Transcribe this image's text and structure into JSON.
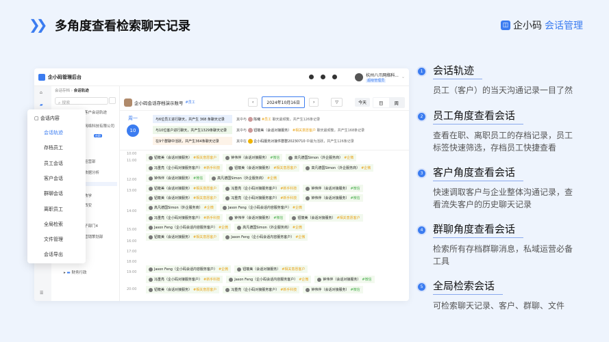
{
  "header": {
    "title": "多角度查看检索聊天记录",
    "brand_a": "企小码",
    "brand_b": "会话管理"
  },
  "app": {
    "name": "企小码管理后台",
    "user": "杭州八爪网络科...",
    "role": "超级管理员",
    "breadcrumb": [
      "会话存档",
      "会话轨迹"
    ],
    "search_placeholder": "搜索",
    "tree_header": "客户会话轨迹",
    "tree_items": [
      "网络科技有限公司",
      "",
      "",
      "运营部",
      "数据分析",
      "",
      "教学",
      "西安",
      "",
      "子部门4",
      "营销策划部",
      "",
      "",
      "财务行政"
    ],
    "tree_tag": "在职",
    "account": "企小码会话存档演示账号",
    "account_tag": "#员工",
    "date": "2024年10月16日",
    "today": "今天",
    "day": "日",
    "week": "周",
    "weekday": "周一",
    "daynum": "10",
    "summary": [
      {
        "text": "与6位员工进行聊天，共产生 368 条聊天记录",
        "detail_pre": "其中与",
        "name": "陈曦",
        "tag": "#员工",
        "detail": "聊天最频繁，共产生126条记录",
        "bg": "#e8f0fd"
      },
      {
        "text": "与10位客户进行聊天，共产生1329条聊天记录",
        "detail_pre": "其中与",
        "name": "钮筱美（会话对接服务）",
        "tag": "#相关意愿客户",
        "detail": "聊天最频繁，共产生168条记录",
        "bg": "#edf7e9"
      },
      {
        "text": "在9个群聊中活跃，共产生364条聊天记录",
        "detail_pre": "其中在",
        "name": "企小码服务对接件群群20230710",
        "tag": "",
        "detail": "中最为活跃，共产生126条记录",
        "bg": "#fdf3e8"
      }
    ],
    "times": [
      "10:00",
      "11:00",
      "12:00",
      "13:00",
      "14:00",
      "15:00",
      "16:00",
      "17:00",
      "18:00",
      "19:00",
      "20:00"
    ],
    "rows": [
      [
        [
          "钮筱美（会话对接服务）",
          "#相关意愿客户",
          1
        ],
        [
          "钟伟伴（会话对接服务）",
          "#微信",
          2
        ],
        [
          "高凡德国Simon（外企服务商）",
          "#企微",
          1
        ]
      ],
      [
        [
          "冯重亮（企小码对接服务客户）",
          "#新手科技",
          1
        ],
        [
          "钮筱美（会话对接服务）",
          "#相关意愿客户",
          1
        ],
        [
          "高凡德国Simon（外企服务商）",
          "#企微",
          1
        ]
      ],
      [
        [
          "钟伟伴（会话对接服务）",
          "#微信",
          2
        ],
        [
          "高凡德国Simon（外企服务商）",
          "#企微",
          1
        ]
      ],
      [
        [
          "钮筱美（会话对接服务）",
          "#相关意愿客户",
          1
        ],
        [
          "冯重亮（企小码对接服务客户）",
          "#新手科技",
          1
        ],
        [
          "钟伟伴（会话对接服务）",
          "#微信",
          2
        ]
      ],
      [
        [
          "钮筱美（会话对接服务）",
          "#相关意愿客户",
          1
        ],
        [
          "冯重亮（企小码对接服务客户）",
          "#新手科技",
          1
        ],
        [
          "钟伟伴（会话对接服务）",
          "#微信",
          2
        ]
      ],
      [
        [
          "高凡德国Simon（外企服务商）",
          "#企微",
          1
        ],
        [
          "Jason Feng（企小码会话内容服务客户）",
          "#企微",
          1
        ]
      ],
      [
        [
          "冯重亮（企小码对接服务客户）",
          "#新手科技",
          1
        ],
        [
          "钟伟伴（会话对接服务）",
          "#微信",
          2
        ],
        [
          "钮筱美（会话对接服务）",
          "#相关意愿客户",
          1
        ]
      ],
      [
        [
          "Jason Feng（企小码会话内容服务客户）",
          "#企微",
          1
        ],
        [
          "高凡德国Simon（外企服务商）",
          "#企微",
          1
        ]
      ],
      [
        [
          "钮筱美（会话对接服务）",
          "#相关意愿客户",
          1
        ],
        [
          "Jason Feng（企小码会话内容服务客户）",
          "#企微",
          1
        ]
      ],
      [
        [
          "Jason Feng（企小码会话内容服务客户）",
          "#企微",
          1
        ],
        [
          "钮筱美（会话对接服务）",
          "#相关意愿客户",
          1
        ]
      ],
      [
        [
          "冯重亮（企小码对接服务客户）",
          "#新手科技",
          1
        ],
        [
          "Jason Feng（企小码会话内容服务客户）",
          "#企微",
          1
        ],
        [
          "钟伟伴（会话对接服务）",
          "#微信",
          2
        ]
      ],
      [
        [
          "钮筱美（会话对接服务）",
          "#相关意愿客户",
          1
        ],
        [
          "冯重亮（企小码对接服务客户）",
          "#新手科技",
          1
        ],
        [
          "钟伟伴（会话对接服务）",
          "#微信",
          2
        ]
      ]
    ]
  },
  "menu": {
    "header": "会话内容",
    "items": [
      "会话轨迹",
      "存档员工",
      "员工会话",
      "客户会话",
      "群聊会话",
      "离职员工",
      "全局检索",
      "文件管理",
      "会话导出"
    ]
  },
  "features": [
    {
      "num": "1",
      "title": "会话轨迹",
      "desc": "员工（客户）的当天沟通记录一目了然"
    },
    {
      "num": "2",
      "title": "员工角度查看会话",
      "desc": "查看在职、离职员工的存档记录，员工标签快速筛选，存档员工快捷查看"
    },
    {
      "num": "3",
      "title": "客户角度查看会话",
      "desc": "快速调取客户与企业整体沟通记录，查看流失客户的历史聊天记录"
    },
    {
      "num": "4",
      "title": "群聊角度查看会话",
      "desc": "检索所有存档群聊消息，私域运营必备工具"
    },
    {
      "num": "5",
      "title": "全局检索会话",
      "desc": "可检索聊天记录、客户、群聊、文件"
    }
  ]
}
